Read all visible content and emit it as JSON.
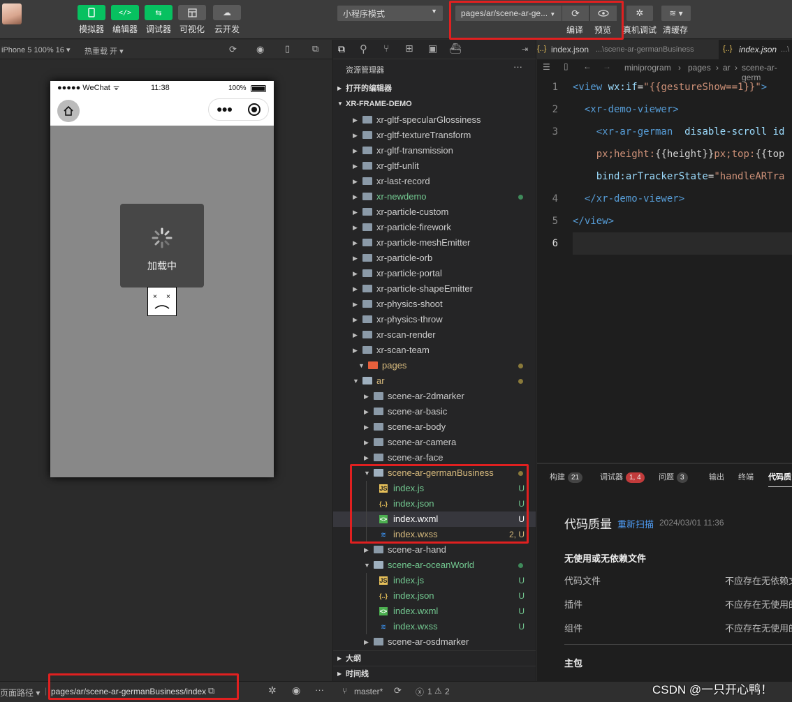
{
  "toolbar": {
    "buttons": [
      {
        "label": "模拟器"
      },
      {
        "label": "编辑器"
      },
      {
        "label": "调试器"
      },
      {
        "label": "可视化"
      },
      {
        "label": "云开发"
      }
    ],
    "mode_select": "小程序模式",
    "page_path": "pages/ar/scene-ar-ge...",
    "compile_label": "编译",
    "preview_label": "预览",
    "real_debug_label": "真机调试",
    "clear_cache_label": "清缓存"
  },
  "subbar": {
    "device": "iPhone 5 100% 16 ▾",
    "hot_reload": "热重载 开 ▾"
  },
  "simulator": {
    "carrier": "●●●●● WeChat",
    "time": "11:38",
    "battery": "100%",
    "loading_text": "加载中"
  },
  "explorer": {
    "title": "资源管理器",
    "more": "···",
    "open_editors": "打开的编辑器",
    "project": "XR-FRAME-DEMO",
    "items": [
      {
        "name": "xr-gltf-specularGlossiness",
        "type": "folder",
        "depth": 1
      },
      {
        "name": "xr-gltf-textureTransform",
        "type": "folder",
        "depth": 1
      },
      {
        "name": "xr-gltf-transmission",
        "type": "folder",
        "depth": 1
      },
      {
        "name": "xr-gltf-unlit",
        "type": "folder",
        "depth": 1
      },
      {
        "name": "xr-last-record",
        "type": "folder",
        "depth": 1
      },
      {
        "name": "xr-newdemo",
        "type": "folder",
        "depth": 1,
        "status": "dot-green",
        "color": "#73c991"
      },
      {
        "name": "xr-particle-custom",
        "type": "folder",
        "depth": 1
      },
      {
        "name": "xr-particle-firework",
        "type": "folder",
        "depth": 1
      },
      {
        "name": "xr-particle-meshEmitter",
        "type": "folder",
        "depth": 1
      },
      {
        "name": "xr-particle-orb",
        "type": "folder",
        "depth": 1
      },
      {
        "name": "xr-particle-portal",
        "type": "folder",
        "depth": 1
      },
      {
        "name": "xr-particle-shapeEmitter",
        "type": "folder",
        "depth": 1
      },
      {
        "name": "xr-physics-shoot",
        "type": "folder",
        "depth": 1
      },
      {
        "name": "xr-physics-throw",
        "type": "folder",
        "depth": 1
      },
      {
        "name": "xr-scan-render",
        "type": "folder",
        "depth": 1
      },
      {
        "name": "xr-scan-team",
        "type": "folder",
        "depth": 1
      },
      {
        "name": "pages",
        "type": "folder-open-red",
        "depth": 0,
        "status": "dot-yellow",
        "color": "#d7ba7d"
      },
      {
        "name": "ar",
        "type": "folder-open",
        "depth": 1,
        "status": "dot-yellow",
        "color": "#d7ba7d"
      },
      {
        "name": "scene-ar-2dmarker",
        "type": "folder",
        "depth": 2
      },
      {
        "name": "scene-ar-basic",
        "type": "folder",
        "depth": 2
      },
      {
        "name": "scene-ar-body",
        "type": "folder",
        "depth": 2
      },
      {
        "name": "scene-ar-camera",
        "type": "folder",
        "depth": 2
      },
      {
        "name": "scene-ar-face",
        "type": "folder",
        "depth": 2
      },
      {
        "name": "scene-ar-germanBusiness",
        "type": "folder-open",
        "depth": 2,
        "status": "dot-yellow",
        "color": "#d7ba7d"
      },
      {
        "name": "index.js",
        "type": "js",
        "depth": 3,
        "badge": "U",
        "color": "#73c991"
      },
      {
        "name": "index.json",
        "type": "json",
        "depth": 3,
        "badge": "U",
        "color": "#73c991"
      },
      {
        "name": "index.wxml",
        "type": "wxml",
        "depth": 3,
        "badge": "U",
        "color": "#ffffff",
        "selected": true
      },
      {
        "name": "index.wxss",
        "type": "wxss",
        "depth": 3,
        "badge": "2, U",
        "color": "#d7ba7d"
      },
      {
        "name": "scene-ar-hand",
        "type": "folder",
        "depth": 2
      },
      {
        "name": "scene-ar-oceanWorld",
        "type": "folder-open",
        "depth": 2,
        "status": "dot-green",
        "color": "#73c991"
      },
      {
        "name": "index.js",
        "type": "js",
        "depth": 3,
        "badge": "U",
        "color": "#73c991"
      },
      {
        "name": "index.json",
        "type": "json",
        "depth": 3,
        "badge": "U",
        "color": "#73c991"
      },
      {
        "name": "index.wxml",
        "type": "wxml",
        "depth": 3,
        "badge": "U",
        "color": "#73c991"
      },
      {
        "name": "index.wxss",
        "type": "wxss",
        "depth": 3,
        "badge": "U",
        "color": "#73c991"
      },
      {
        "name": "scene-ar-osdmarker",
        "type": "folder",
        "depth": 2
      }
    ],
    "outline": "大纲",
    "timeline": "时间线"
  },
  "editor": {
    "tab1_name": "index.json",
    "tab1_path": "...\\scene-ar-germanBusiness",
    "tab2_name": "index.json",
    "tab2_path": "...\\",
    "breadcrumb": [
      "miniprogram",
      "pages",
      "ar",
      "scene-ar-germ"
    ],
    "lines": [
      {
        "num": "1",
        "segs": [
          [
            "<view ",
            "#569cd6"
          ],
          [
            "wx:if",
            "#9cdcfe"
          ],
          [
            "=",
            "#d4d4d4"
          ],
          [
            "\"{{gestureShow==1}}\"",
            "#ce9178"
          ],
          [
            ">",
            "#569cd6"
          ]
        ]
      },
      {
        "num": "2",
        "segs": [
          [
            "  <xr-demo-viewer>",
            "#569cd6"
          ]
        ]
      },
      {
        "num": "3",
        "segs": [
          [
            "    <xr-ar-german  ",
            "#569cd6"
          ],
          [
            "disable-scroll id",
            "#9cdcfe"
          ]
        ]
      },
      {
        "num": "",
        "segs": [
          [
            "    px;height:",
            "#ce9178"
          ],
          [
            "{{height}}",
            "#d4d4d4"
          ],
          [
            "px;top:",
            "#ce9178"
          ],
          [
            "{{top",
            "#d4d4d4"
          ]
        ]
      },
      {
        "num": "",
        "segs": [
          [
            "    bind:arTrackerState",
            "#9cdcfe"
          ],
          [
            "=",
            "#d4d4d4"
          ],
          [
            "\"handleARTra",
            "#ce9178"
          ]
        ]
      },
      {
        "num": "4",
        "segs": [
          [
            "  </xr-demo-viewer>",
            "#569cd6"
          ]
        ]
      },
      {
        "num": "5",
        "segs": [
          [
            "</view>",
            "#569cd6"
          ]
        ]
      },
      {
        "num": "6",
        "segs": [
          [
            "",
            ""
          ]
        ]
      }
    ]
  },
  "panel": {
    "tabs": [
      {
        "label": "构建",
        "count": "21"
      },
      {
        "label": "调试器",
        "count": "1, 4"
      },
      {
        "label": "问题",
        "count": "3"
      },
      {
        "label": "输出",
        "count": ""
      },
      {
        "label": "终端",
        "count": ""
      },
      {
        "label": "代码质",
        "count": ""
      }
    ],
    "title": "代码质量",
    "rescan": "重新扫描",
    "date": "2024/03/01 11:36",
    "section": "无使用或无依赖文件",
    "rows": [
      {
        "label": "代码文件",
        "value": "不应存在无依赖文"
      },
      {
        "label": "插件",
        "value": "不应存在无使用的"
      },
      {
        "label": "组件",
        "value": "不应存在无使用的"
      }
    ],
    "section2": "主包"
  },
  "bottom": {
    "page_path_label": "页面路径 ▾",
    "page_path": "pages/ar/scene-ar-germanBusiness/index",
    "branch": "master*",
    "errors": "1",
    "warnings": "2"
  },
  "watermark": "CSDN @一只开心鸭！"
}
